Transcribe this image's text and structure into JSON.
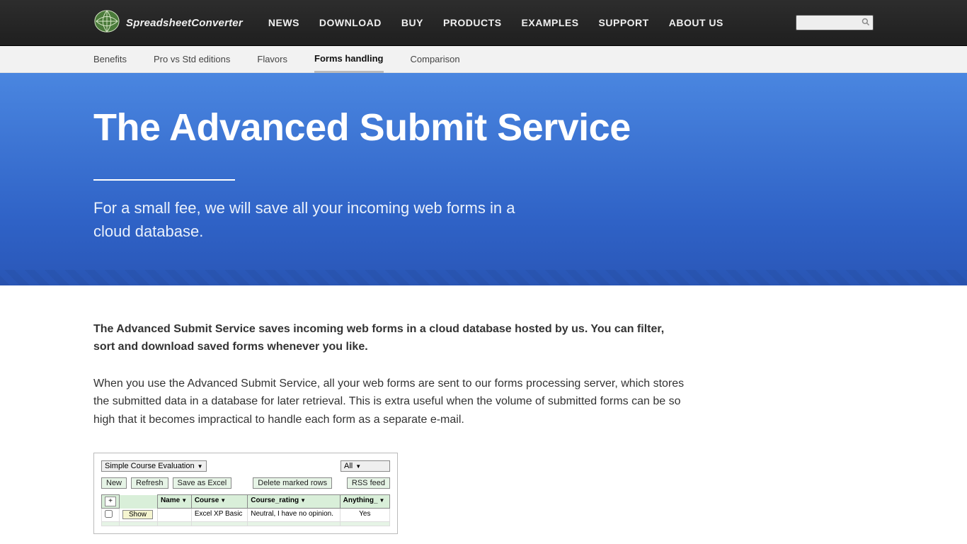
{
  "brand": "SpreadsheetConverter",
  "topnav": [
    "NEWS",
    "DOWNLOAD",
    "BUY",
    "PRODUCTS",
    "EXAMPLES",
    "SUPPORT",
    "ABOUT US"
  ],
  "subnav": {
    "items": [
      "Benefits",
      "Pro vs Std editions",
      "Flavors",
      "Forms handling",
      "Comparison"
    ],
    "active_index": 3
  },
  "hero": {
    "title": "The Advanced Submit Service",
    "subtitle": "For a small fee, we will save all your incoming web forms in a cloud database."
  },
  "content": {
    "intro": "The Advanced Submit Service saves incoming web forms in a cloud database hosted by us. You can filter, sort and download saved forms whenever you like.",
    "para1": "When you use the Advanced Submit Service, all your web forms are sent to our forms processing server, which stores the submitted data in a database for later retrieval. This is extra useful when the volume of submitted forms can be so high that it becomes impractical to handle each form as a separate e-mail."
  },
  "panel": {
    "select_left": "Simple Course Evaluation",
    "select_right": "All",
    "buttons": {
      "new": "New",
      "refresh": "Refresh",
      "save_excel": "Save as Excel",
      "delete": "Delete marked rows",
      "rss": "RSS feed"
    },
    "plus": "+",
    "headers": [
      "Name",
      "Course",
      "Course_rating",
      "Anything_"
    ],
    "row1": {
      "show": "Show",
      "course": "Excel XP Basic",
      "rating": "Neutral, I have no opinion.",
      "anything": "Yes"
    }
  }
}
